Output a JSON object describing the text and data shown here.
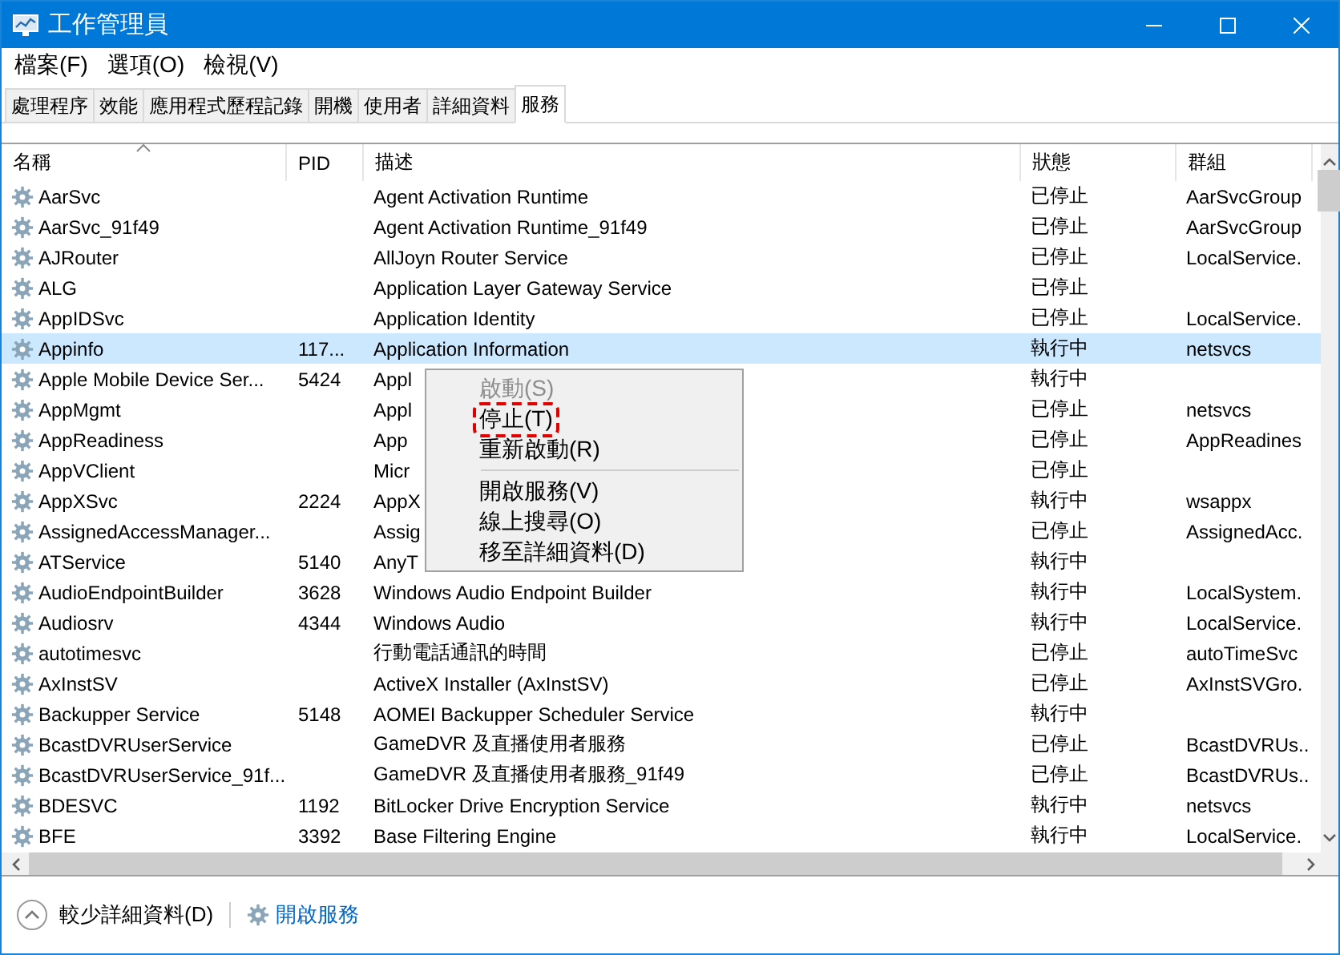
{
  "window": {
    "title": "工作管理員"
  },
  "menu_bar": [
    "檔案(F)",
    "選項(O)",
    "檢視(V)"
  ],
  "tabs": [
    {
      "label": "處理程序",
      "selected": false
    },
    {
      "label": "效能",
      "selected": false
    },
    {
      "label": "應用程式歷程記錄",
      "selected": false
    },
    {
      "label": "開機",
      "selected": false
    },
    {
      "label": "使用者",
      "selected": false
    },
    {
      "label": "詳細資料",
      "selected": false
    },
    {
      "label": "服務",
      "selected": true
    }
  ],
  "table": {
    "columns": [
      "名稱",
      "PID",
      "描述",
      "狀態",
      "群組"
    ],
    "rows": [
      {
        "name": "AarSvc",
        "pid": "",
        "description": "Agent Activation Runtime",
        "status": "已停止",
        "group": "AarSvcGroup",
        "selected": false
      },
      {
        "name": "AarSvc_91f49",
        "pid": "",
        "description": "Agent Activation Runtime_91f49",
        "status": "已停止",
        "group": "AarSvcGroup",
        "selected": false
      },
      {
        "name": "AJRouter",
        "pid": "",
        "description": "AllJoyn Router Service",
        "status": "已停止",
        "group": "LocalService.",
        "selected": false
      },
      {
        "name": "ALG",
        "pid": "",
        "description": "Application Layer Gateway Service",
        "status": "已停止",
        "group": "",
        "selected": false
      },
      {
        "name": "AppIDSvc",
        "pid": "",
        "description": "Application Identity",
        "status": "已停止",
        "group": "LocalService.",
        "selected": false
      },
      {
        "name": "Appinfo",
        "pid": "117...",
        "description": "Application Information",
        "status": "執行中",
        "group": "netsvcs",
        "selected": true
      },
      {
        "name": "Apple Mobile Device Ser...",
        "pid": "5424",
        "description": "Appl",
        "status": "執行中",
        "group": "",
        "selected": false
      },
      {
        "name": "AppMgmt",
        "pid": "",
        "description": "Appl",
        "status": "已停止",
        "group": "netsvcs",
        "selected": false
      },
      {
        "name": "AppReadiness",
        "pid": "",
        "description": "App",
        "status": "已停止",
        "group": "AppReadines",
        "selected": false
      },
      {
        "name": "AppVClient",
        "pid": "",
        "description": "Micr",
        "status": "已停止",
        "group": "",
        "selected": false
      },
      {
        "name": "AppXSvc",
        "pid": "2224",
        "description": "AppX",
        "status": "執行中",
        "group": "wsappx",
        "selected": false
      },
      {
        "name": "AssignedAccessManager...",
        "pid": "",
        "description": "Assig",
        "status": "已停止",
        "group": "AssignedAcc.",
        "selected": false
      },
      {
        "name": "ATService",
        "pid": "5140",
        "description": "AnyT",
        "status": "執行中",
        "group": "",
        "selected": false
      },
      {
        "name": "AudioEndpointBuilder",
        "pid": "3628",
        "description": "Windows Audio Endpoint Builder",
        "status": "執行中",
        "group": "LocalSystem.",
        "selected": false
      },
      {
        "name": "Audiosrv",
        "pid": "4344",
        "description": "Windows Audio",
        "status": "執行中",
        "group": "LocalService.",
        "selected": false
      },
      {
        "name": "autotimesvc",
        "pid": "",
        "description": "行動電話通訊的時間",
        "status": "已停止",
        "group": "autoTimeSvc",
        "selected": false
      },
      {
        "name": "AxInstSV",
        "pid": "",
        "description": "ActiveX Installer (AxInstSV)",
        "status": "已停止",
        "group": "AxInstSVGro.",
        "selected": false
      },
      {
        "name": "Backupper Service",
        "pid": "5148",
        "description": "AOMEI Backupper Scheduler Service",
        "status": "執行中",
        "group": "",
        "selected": false
      },
      {
        "name": "BcastDVRUserService",
        "pid": "",
        "description": "GameDVR 及直播使用者服務",
        "status": "已停止",
        "group": "BcastDVRUs..",
        "selected": false
      },
      {
        "name": "BcastDVRUserService_91f...",
        "pid": "",
        "description": "GameDVR 及直播使用者服務_91f49",
        "status": "已停止",
        "group": "BcastDVRUs..",
        "selected": false
      },
      {
        "name": "BDESVC",
        "pid": "1192",
        "description": "BitLocker Drive Encryption Service",
        "status": "執行中",
        "group": "netsvcs",
        "selected": false
      },
      {
        "name": "BFE",
        "pid": "3392",
        "description": "Base Filtering Engine",
        "status": "執行中",
        "group": "LocalService.",
        "selected": false
      }
    ]
  },
  "context_menu": {
    "groups": [
      [
        {
          "label": "啟動(S)",
          "disabled": true,
          "highlighted": false
        },
        {
          "label": "停止(T)",
          "disabled": false,
          "highlighted": true
        },
        {
          "label": "重新啟動(R)",
          "disabled": false,
          "highlighted": false
        }
      ],
      [
        {
          "label": "開啟服務(V)",
          "disabled": false,
          "highlighted": false
        },
        {
          "label": "線上搜尋(O)",
          "disabled": false,
          "highlighted": false
        },
        {
          "label": "移至詳細資料(D)",
          "disabled": false,
          "highlighted": false
        }
      ]
    ]
  },
  "footer": {
    "fewer_details": "較少詳細資料(D)",
    "open_services": "開啟服務"
  }
}
